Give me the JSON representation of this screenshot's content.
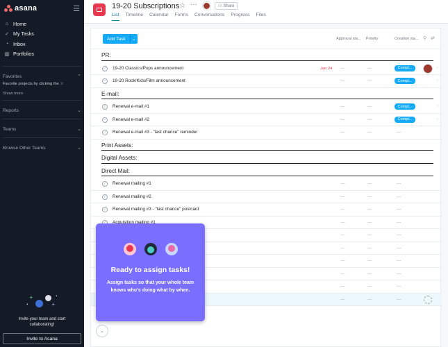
{
  "sidebar": {
    "logo_text": "asana",
    "nav": [
      {
        "label": "Home",
        "icon": "home-icon"
      },
      {
        "label": "My Tasks",
        "icon": "check-circle-icon"
      },
      {
        "label": "Inbox",
        "icon": "bell-icon"
      },
      {
        "label": "Portfolios",
        "icon": "bar-chart-icon"
      }
    ],
    "favorites_label": "Favorites",
    "favorites_hint": "Favorite projects by clicking the ☆",
    "show_more": "Show more",
    "reports_label": "Reports",
    "teams_label": "Teams",
    "browse_label": "Browse Other Teams",
    "invite_text_1": "Invite your team and start",
    "invite_text_2": "collaborating!",
    "invite_button": "Invite to Asana"
  },
  "header": {
    "project_title": "19-20 Subscriptions",
    "share_label": "Share",
    "tabs": [
      "List",
      "Timeline",
      "Calendar",
      "Forms",
      "Conversations",
      "Progress",
      "Files"
    ],
    "active_tab": "List"
  },
  "toolbar": {
    "add_task_label": "Add Task",
    "columns": [
      "Approval sta...",
      "Priority",
      "Creation sta..."
    ]
  },
  "list": {
    "sections": [
      {
        "title": "PR:",
        "tasks": [
          {
            "name": "19-20 Classics/Pops announcement",
            "due": "Jan 24",
            "approval": "---",
            "priority": "---",
            "status": "Compl...",
            "avatar": true
          },
          {
            "name": "19-20 Rock/Kids/Film announcement",
            "due": "",
            "approval": "---",
            "priority": "---",
            "status": "Compl..."
          }
        ]
      },
      {
        "title": "E-mail:",
        "tasks": [
          {
            "name": "Renewal e-mail #1",
            "due": "",
            "approval": "---",
            "priority": "---",
            "status": "Compl..."
          },
          {
            "name": "Renewal e-mail #2",
            "due": "",
            "approval": "---",
            "priority": "---",
            "status": "Compl..."
          },
          {
            "name": "Renewal e-mail #3 - \"last chance\" reminder",
            "due": "",
            "approval": "---",
            "priority": "---",
            "status": "---"
          }
        ]
      },
      {
        "title": "Print Assets:",
        "tasks": []
      },
      {
        "title": "Digital Assets:",
        "tasks": []
      },
      {
        "title": "Direct Mail:",
        "tasks": [
          {
            "name": "Renewal mailing #1",
            "due": "",
            "approval": "---",
            "priority": "---",
            "status": "---"
          },
          {
            "name": "Renewal mailing #2",
            "due": "",
            "approval": "---",
            "priority": "---",
            "status": "---"
          },
          {
            "name": "Renewal mailing #3 - \"last chance\" postcard",
            "due": "",
            "approval": "---",
            "priority": "---",
            "status": "---"
          },
          {
            "name": "Acquisition mailing #1",
            "due": "",
            "approval": "---",
            "priority": "---",
            "status": "---"
          },
          {
            "name": "",
            "due": "",
            "approval": "---",
            "priority": "---",
            "status": "---"
          },
          {
            "name": "",
            "due": "",
            "approval": "---",
            "priority": "---",
            "status": "---"
          },
          {
            "name": "",
            "due": "",
            "approval": "---",
            "priority": "---",
            "status": "---"
          },
          {
            "name": "",
            "due": "",
            "approval": "---",
            "priority": "---",
            "status": "---"
          },
          {
            "name": "",
            "due": "",
            "approval": "---",
            "priority": "---",
            "status": "---"
          },
          {
            "name": "",
            "due": "",
            "approval": "---",
            "priority": "---",
            "status": "---",
            "selected": true,
            "empty_avatar": true
          }
        ]
      }
    ]
  },
  "popup": {
    "title": "Ready to assign tasks!",
    "body": "Assign tasks so that your whole team knows who's doing what by when."
  },
  "colors": {
    "sidebar_bg": "#151b26",
    "accent_blue": "#14aaf5",
    "popup_purple": "#796eff",
    "project_red": "#e8384f"
  }
}
